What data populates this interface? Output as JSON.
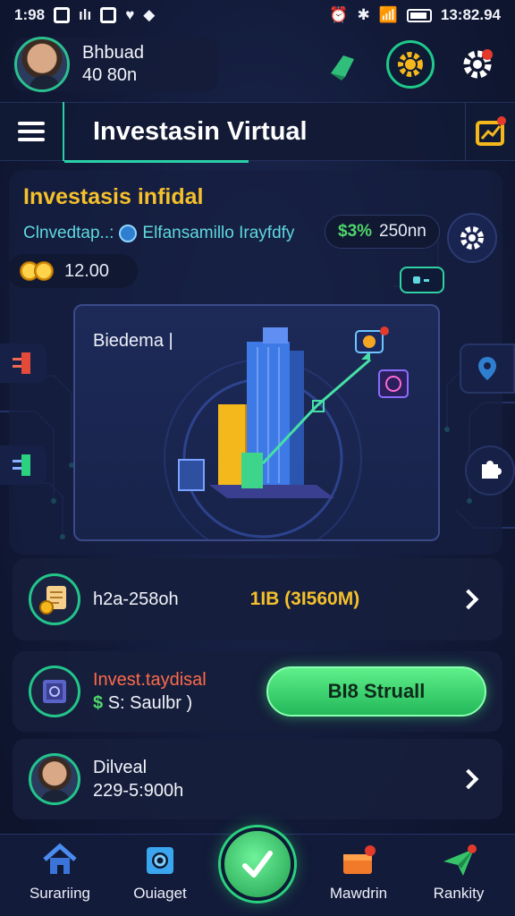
{
  "status_bar": {
    "left_text": "1:98",
    "left_icons": [
      "box-icon",
      "signal-alt-icon",
      "box-icon",
      "shield-icon",
      "diamond-icon"
    ],
    "right_time": "13:82.94"
  },
  "header": {
    "profile_name": "Bhbuad",
    "profile_amount": "40 80n"
  },
  "title_bar": {
    "title": "Investasin Virtual"
  },
  "hero": {
    "title": "Investasis infidal",
    "subtitle_left": "Clnvedtap..:",
    "subtitle_right": "Elfansamillo Irayfdfy",
    "percent": "$3%",
    "percent_value": "250nn",
    "coin_value": "12.00",
    "illustration_label": "Biedema |"
  },
  "rows": {
    "row1": {
      "label": "h2a-258oh",
      "value": "1IB (3I560M)"
    },
    "row2": {
      "title": "Invest.taydisal",
      "sub_prefix": "$",
      "sub_text": "S: Saulbr )",
      "cta_label": "BI8 Struall"
    },
    "row3": {
      "line1": "Dilveal",
      "line2": "229-5:900h"
    }
  },
  "bottom_nav": {
    "items": [
      {
        "label": "Surariing"
      },
      {
        "label": "Ouiaget"
      },
      {
        "label": "Mawdrin"
      },
      {
        "label": "Rankity"
      }
    ]
  },
  "colors": {
    "accent_green": "#2ad1a8",
    "gold": "#f5c02c",
    "cta_green": "#3fd46f",
    "background": "#121a38"
  }
}
